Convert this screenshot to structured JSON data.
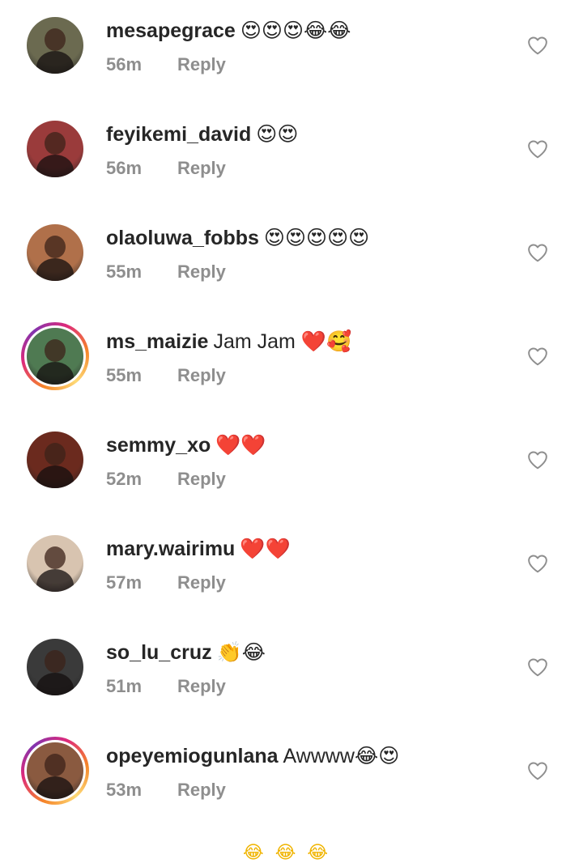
{
  "reply_label": "Reply",
  "colors": {
    "username": "#262626",
    "meta": "#8e8e8e",
    "heart_outline": "#8e8e8e",
    "story_ring_start": "#f58529",
    "story_ring_end": "#8134af"
  },
  "icons": {
    "like": "heart-outline-icon"
  },
  "comments": [
    {
      "username": "mesapegrace",
      "message": "😍😍😍😂😂",
      "time": "56m",
      "story": false,
      "avatar_color": "#6b6a50"
    },
    {
      "username": "feyikemi_david",
      "message": "😍😍",
      "time": "56m",
      "story": false,
      "avatar_color": "#9a3b3b"
    },
    {
      "username": "olaoluwa_fobbs",
      "message": "😍😍😍😍😍",
      "time": "55m",
      "story": false,
      "avatar_color": "#b0704a"
    },
    {
      "username": "ms_maizie",
      "message": "Jam Jam ❤️🥰",
      "time": "55m",
      "story": true,
      "avatar_color": "#4f7a52"
    },
    {
      "username": "semmy_xo",
      "message": "❤️❤️",
      "time": "52m",
      "story": false,
      "avatar_color": "#6b2a1e"
    },
    {
      "username": "mary.wairimu",
      "message": "❤️❤️",
      "time": "57m",
      "story": false,
      "avatar_color": "#d8c4b0"
    },
    {
      "username": "so_lu_cruz",
      "message": "👏😂",
      "time": "51m",
      "story": false,
      "avatar_color": "#3a3a3a"
    },
    {
      "username": "opeyemiogunlana",
      "message": "Awwww😂😍",
      "time": "53m",
      "story": true,
      "avatar_color": "#8a5a40"
    }
  ],
  "partial_next": "😂😂😂"
}
